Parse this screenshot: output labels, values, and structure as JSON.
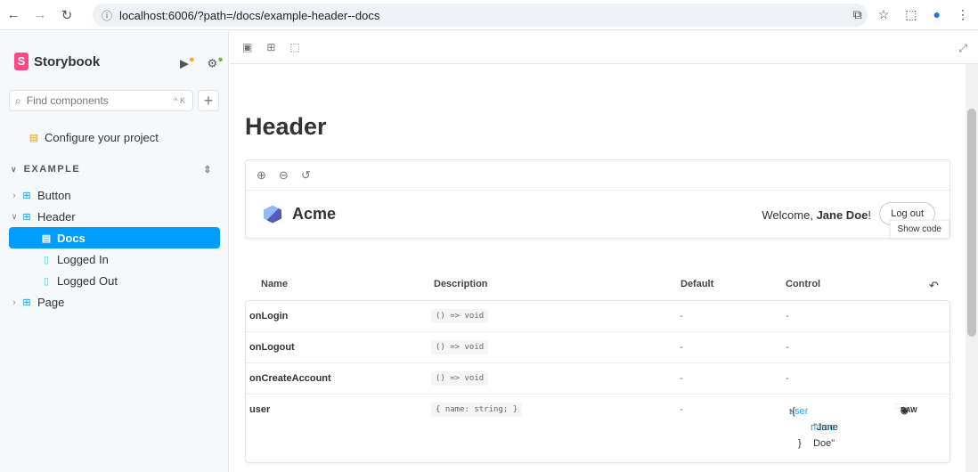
{
  "browser": {
    "url": "localhost:6006/?path=/docs/example-header--docs"
  },
  "sidebar": {
    "brand": "Storybook",
    "search_placeholder": "Find components",
    "shortcut": "^ K",
    "configure": "Configure your project",
    "section": "EXAMPLE",
    "items": [
      {
        "label": "Button"
      },
      {
        "label": "Header"
      },
      {
        "label": "Docs"
      },
      {
        "label": "Logged In"
      },
      {
        "label": "Logged Out"
      },
      {
        "label": "Page"
      }
    ]
  },
  "main": {
    "title": "Header",
    "preview": {
      "brand": "Acme",
      "welcome": "Welcome, ",
      "user": "Jane Doe",
      "exclaim": "!",
      "logout": "Log out",
      "show_code": "Show code"
    },
    "table": {
      "headers": [
        "Name",
        "Description",
        "Default",
        "Control"
      ],
      "rows": [
        {
          "name": "onLogin",
          "desc": "() => void",
          "default": "-",
          "control": "-"
        },
        {
          "name": "onLogout",
          "desc": "() => void",
          "default": "-",
          "control": "-"
        },
        {
          "name": "onCreateAccount",
          "desc": "() => void",
          "default": "-",
          "control": "-"
        },
        {
          "name": "user",
          "desc": "{ name: string; }",
          "default": "-"
        }
      ],
      "json": {
        "key": "user",
        "open": "{",
        "subkey": "name",
        "value": "\"Jane Doe\"",
        "close": "}"
      },
      "raw": "RAW"
    }
  }
}
